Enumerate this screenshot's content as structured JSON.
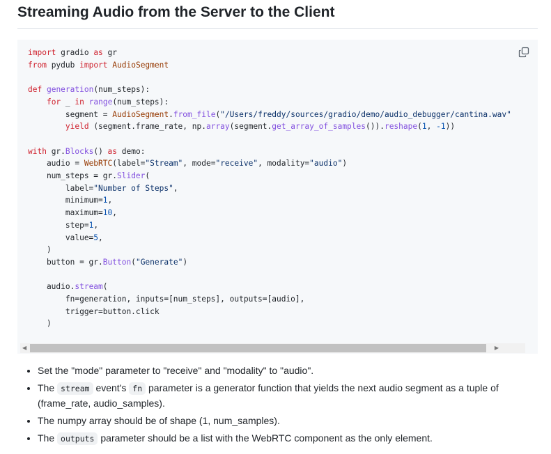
{
  "title": "Streaming Audio from the Server to the Client",
  "code_lines": [
    [
      [
        "import",
        "k"
      ],
      [
        " gradio ",
        ""
      ],
      [
        "as",
        "k"
      ],
      [
        " gr",
        ""
      ]
    ],
    [
      [
        "from",
        "k"
      ],
      [
        " pydub ",
        ""
      ],
      [
        "import",
        "k"
      ],
      [
        " ",
        ""
      ],
      [
        "AudioSegment",
        "c"
      ]
    ],
    [],
    [
      [
        "def",
        "k"
      ],
      [
        " ",
        ""
      ],
      [
        "generation",
        "f"
      ],
      [
        "(num_steps):",
        ""
      ]
    ],
    [
      [
        "    ",
        ""
      ],
      [
        "for",
        "k"
      ],
      [
        " _ ",
        ""
      ],
      [
        "in",
        "k"
      ],
      [
        " ",
        ""
      ],
      [
        "range",
        "f"
      ],
      [
        "(num_steps):",
        ""
      ]
    ],
    [
      [
        "        segment = ",
        ""
      ],
      [
        "AudioSegment",
        "c"
      ],
      [
        ".",
        ""
      ],
      [
        "from_file",
        "f"
      ],
      [
        "(",
        ""
      ],
      [
        "\"/Users/freddy/sources/gradio/demo/audio_debugger/cantina.wav\"",
        "s"
      ]
    ],
    [
      [
        "        ",
        ""
      ],
      [
        "yield",
        "k"
      ],
      [
        " (segment.frame_rate, np.",
        ""
      ],
      [
        "array",
        "f"
      ],
      [
        "(segment.",
        ""
      ],
      [
        "get_array_of_samples",
        "f"
      ],
      [
        "()).",
        ""
      ],
      [
        "reshape",
        "f"
      ],
      [
        "(",
        ""
      ],
      [
        "1",
        "n"
      ],
      [
        ", ",
        ""
      ],
      [
        "-1",
        "n"
      ],
      [
        "))",
        ""
      ]
    ],
    [],
    [
      [
        "with",
        "k"
      ],
      [
        " gr.",
        ""
      ],
      [
        "Blocks",
        "f"
      ],
      [
        "() ",
        ""
      ],
      [
        "as",
        "k"
      ],
      [
        " demo:",
        ""
      ]
    ],
    [
      [
        "    audio = ",
        ""
      ],
      [
        "WebRTC",
        "c"
      ],
      [
        "(label=",
        ""
      ],
      [
        "\"Stream\"",
        "s"
      ],
      [
        ", mode=",
        ""
      ],
      [
        "\"receive\"",
        "s"
      ],
      [
        ", modality=",
        ""
      ],
      [
        "\"audio\"",
        "s"
      ],
      [
        ")",
        ""
      ]
    ],
    [
      [
        "    num_steps = gr.",
        ""
      ],
      [
        "Slider",
        "f"
      ],
      [
        "(",
        ""
      ]
    ],
    [
      [
        "        label=",
        ""
      ],
      [
        "\"Number of Steps\"",
        "s"
      ],
      [
        ",",
        ""
      ]
    ],
    [
      [
        "        minimum=",
        ""
      ],
      [
        "1",
        "n"
      ],
      [
        ",",
        ""
      ]
    ],
    [
      [
        "        maximum=",
        ""
      ],
      [
        "10",
        "n"
      ],
      [
        ",",
        ""
      ]
    ],
    [
      [
        "        step=",
        ""
      ],
      [
        "1",
        "n"
      ],
      [
        ",",
        ""
      ]
    ],
    [
      [
        "        value=",
        ""
      ],
      [
        "5",
        "n"
      ],
      [
        ",",
        ""
      ]
    ],
    [
      [
        "    )",
        ""
      ]
    ],
    [
      [
        "    button = gr.",
        ""
      ],
      [
        "Button",
        "f"
      ],
      [
        "(",
        ""
      ],
      [
        "\"Generate\"",
        "s"
      ],
      [
        ")",
        ""
      ]
    ],
    [],
    [
      [
        "    audio.",
        ""
      ],
      [
        "stream",
        "f"
      ],
      [
        "(",
        ""
      ]
    ],
    [
      [
        "        fn=generation, inputs=[num_steps], outputs=[audio],",
        ""
      ]
    ],
    [
      [
        "        trigger=button.click",
        ""
      ]
    ],
    [
      [
        "    )",
        ""
      ]
    ]
  ],
  "bullets": [
    [
      {
        "t": "Set the \"mode\" parameter to \"receive\" and \"modality\" to \"audio\"."
      }
    ],
    [
      {
        "t": "The "
      },
      {
        "c": "stream"
      },
      {
        "t": " event's "
      },
      {
        "c": "fn"
      },
      {
        "t": " parameter is a generator function that yields the next audio segment as a tuple of (frame_rate, audio_samples)."
      }
    ],
    [
      {
        "t": "The numpy array should be of shape (1, num_samples)."
      }
    ],
    [
      {
        "t": "The "
      },
      {
        "c": "outputs"
      },
      {
        "t": " parameter should be a list with the WebRTC component as the only element."
      }
    ]
  ]
}
